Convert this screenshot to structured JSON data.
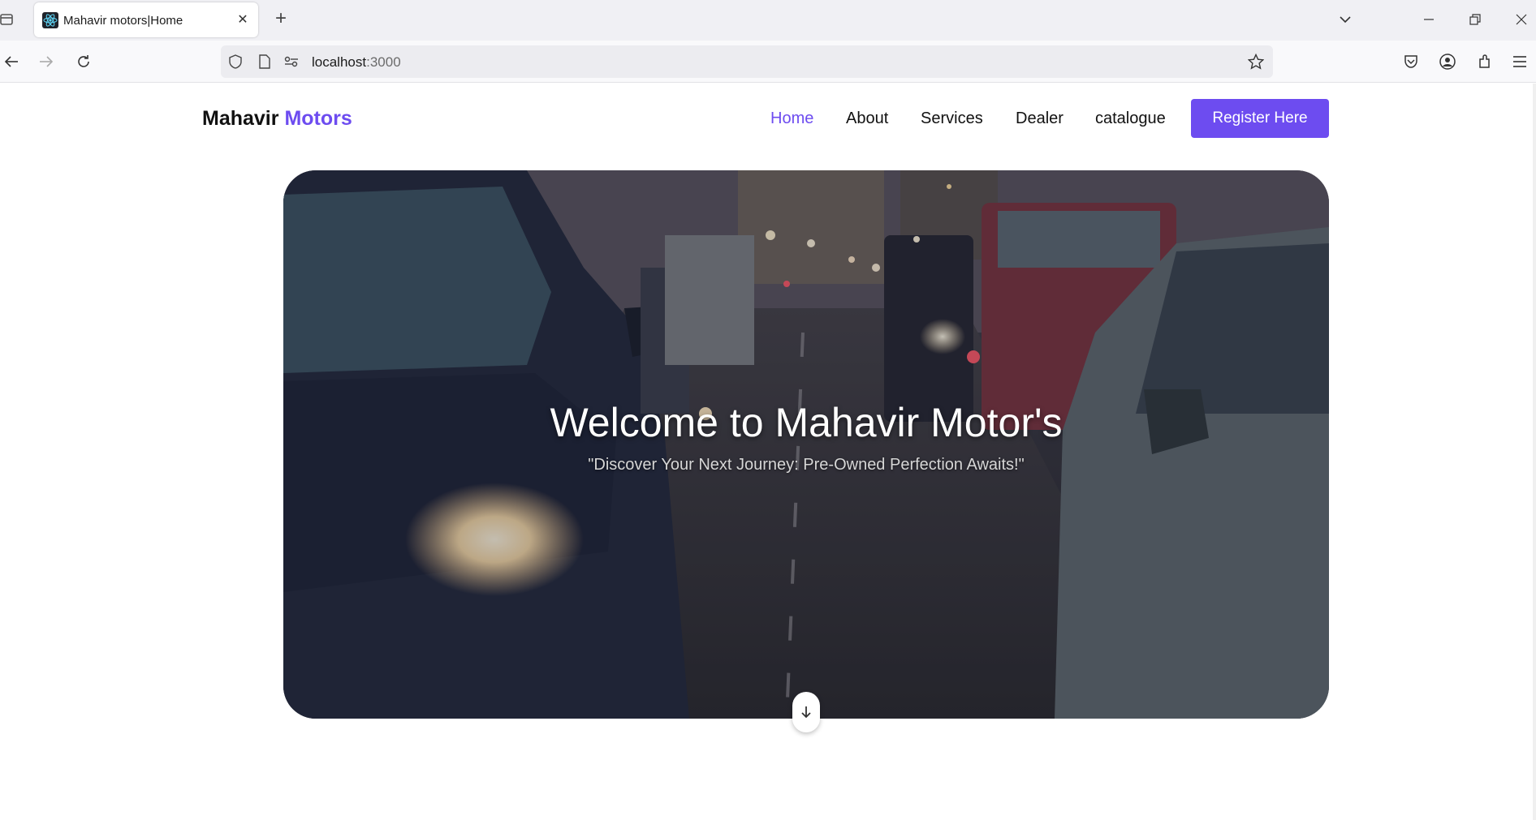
{
  "browser": {
    "tab_title": "Mahavir motors|Home",
    "url_host": "localhost",
    "url_port": ":3000",
    "icons": [
      "tab-list-icon",
      "react-favicon-icon",
      "close-icon",
      "plus-icon",
      "chevron-down-icon",
      "minimize-icon",
      "restore-icon",
      "window-close-icon",
      "back-icon",
      "forward-icon",
      "reload-icon",
      "shield-icon",
      "page-icon",
      "permissions-icon",
      "star-icon",
      "pocket-icon",
      "account-icon",
      "extensions-icon",
      "menu-icon"
    ]
  },
  "site": {
    "logo_main": "Mahavir",
    "logo_accent": "Motors",
    "accent_color": "#6d4cf0",
    "nav": {
      "home": "Home",
      "about": "About",
      "services": "Services",
      "dealer": "Dealer",
      "catalogue": "catalogue"
    },
    "register_label": "Register Here"
  },
  "hero": {
    "title": "Welcome to Mahavir Motor's",
    "subtitle": "\"Discover Your Next Journey: Pre-Owned Perfection Awaits!\"",
    "scroll_icon": "arrow-down-icon"
  }
}
